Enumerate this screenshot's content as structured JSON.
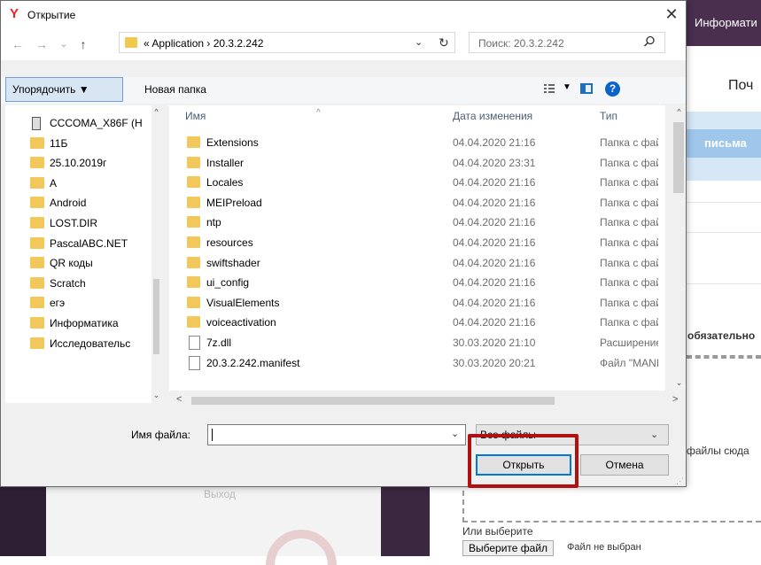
{
  "background": {
    "tab_label": "Информати",
    "header_text": "Поч",
    "band_button": "письма",
    "required_label": "обязательно",
    "drop_text": "файлы сюда",
    "exit_label": "Выход",
    "choose_label": "Или выберите",
    "choose_button": "Выберите файл",
    "no_file_label": "Файл не выбран"
  },
  "dialog": {
    "title": "Открытие",
    "close_glyph": "✕",
    "nav": {
      "back": "←",
      "forward": "→",
      "recent": "⌄",
      "up": "↑",
      "path_prefix": "«",
      "path": "Application  ›  20.3.2.242",
      "search_placeholder": "Поиск: 20.3.2.242"
    },
    "toolbar": {
      "organize": "Упорядочить ▼",
      "new_folder": "Новая папка",
      "help": "?"
    },
    "tree": [
      {
        "label": "CCCOMA_X86F (H",
        "kind": "drive"
      },
      {
        "label": "11Б",
        "kind": "folder"
      },
      {
        "label": "25.10.2019г",
        "kind": "folder"
      },
      {
        "label": "A",
        "kind": "folder"
      },
      {
        "label": "Android",
        "kind": "folder"
      },
      {
        "label": "LOST.DIR",
        "kind": "folder"
      },
      {
        "label": "PascalABC.NET",
        "kind": "folder"
      },
      {
        "label": "QR коды",
        "kind": "folder"
      },
      {
        "label": "Scratch",
        "kind": "folder"
      },
      {
        "label": "егэ",
        "kind": "folder"
      },
      {
        "label": "Информатика",
        "kind": "folder"
      },
      {
        "label": "Исследовательс",
        "kind": "folder"
      }
    ],
    "columns": {
      "name": "Имя",
      "date": "Дата изменения",
      "type": "Тип"
    },
    "files": [
      {
        "name": "Extensions",
        "date": "04.04.2020 21:16",
        "type": "Папка с фай",
        "kind": "folder"
      },
      {
        "name": "Installer",
        "date": "04.04.2020 23:31",
        "type": "Папка с фай",
        "kind": "folder"
      },
      {
        "name": "Locales",
        "date": "04.04.2020 21:16",
        "type": "Папка с фай",
        "kind": "folder"
      },
      {
        "name": "MEIPreload",
        "date": "04.04.2020 21:16",
        "type": "Папка с фай",
        "kind": "folder"
      },
      {
        "name": "ntp",
        "date": "04.04.2020 21:16",
        "type": "Папка с фай",
        "kind": "folder"
      },
      {
        "name": "resources",
        "date": "04.04.2020 21:16",
        "type": "Папка с фай",
        "kind": "folder"
      },
      {
        "name": "swiftshader",
        "date": "04.04.2020 21:16",
        "type": "Папка с фай",
        "kind": "folder"
      },
      {
        "name": "ui_config",
        "date": "04.04.2020 21:16",
        "type": "Папка с фай",
        "kind": "folder"
      },
      {
        "name": "VisualElements",
        "date": "04.04.2020 21:16",
        "type": "Папка с фай",
        "kind": "folder"
      },
      {
        "name": "voiceactivation",
        "date": "04.04.2020 21:16",
        "type": "Папка с фай",
        "kind": "folder"
      },
      {
        "name": "7z.dll",
        "date": "30.03.2020 21:10",
        "type": "Расширение",
        "kind": "dll"
      },
      {
        "name": "20.3.2.242.manifest",
        "date": "30.03.2020 20:21",
        "type": "Файл \"MANI",
        "kind": "file"
      }
    ],
    "bottom": {
      "filename_label": "Имя файла:",
      "filename_value": "",
      "filter": "Все файлы",
      "open": "Открыть",
      "cancel": "Отмена"
    },
    "colors": {
      "accent": "#0078d7",
      "highlight": "#b01010",
      "folder": "#f3c85a"
    }
  }
}
